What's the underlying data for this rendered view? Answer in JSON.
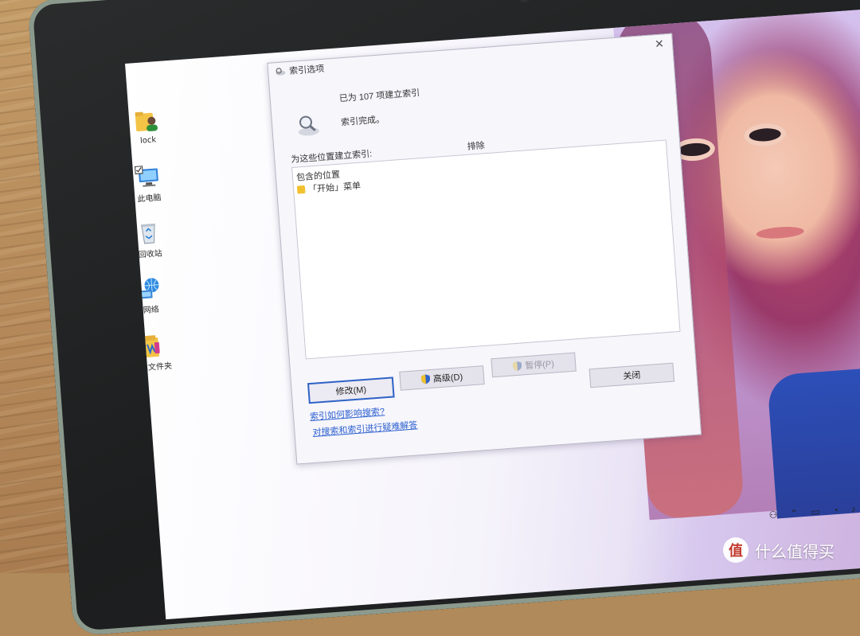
{
  "desktop": {
    "icons": [
      {
        "label": "lock",
        "icon": "user-folder-icon"
      },
      {
        "label": "此电脑",
        "icon": "computer-icon"
      },
      {
        "label": "回收站",
        "icon": "recycle-bin-icon"
      },
      {
        "label": "网络",
        "icon": "network-icon"
      },
      {
        "label": "新建文件夹",
        "icon": "folder-icon"
      }
    ]
  },
  "dialog": {
    "title": "索引选项",
    "status": "已为 107 项建立索引",
    "sub_status": "索引完成。",
    "section_label": "为这些位置建立索引:",
    "exclude_header": "排除",
    "locations_header": "包含的位置",
    "locations": [
      {
        "name": "「开始」菜单"
      }
    ],
    "buttons": {
      "modify": "修改(M)",
      "advanced": "高级(D)",
      "pause": "暂停(P)",
      "close": "关闭"
    },
    "links": {
      "how_affects": "索引如何影响搜索?",
      "troubleshoot": "对搜索和索引进行疑难解答"
    }
  },
  "colors": {
    "accent": "#2e63c7",
    "link": "#2b5fd0"
  },
  "watermark": {
    "text": "什么值得买",
    "logo": "值"
  }
}
